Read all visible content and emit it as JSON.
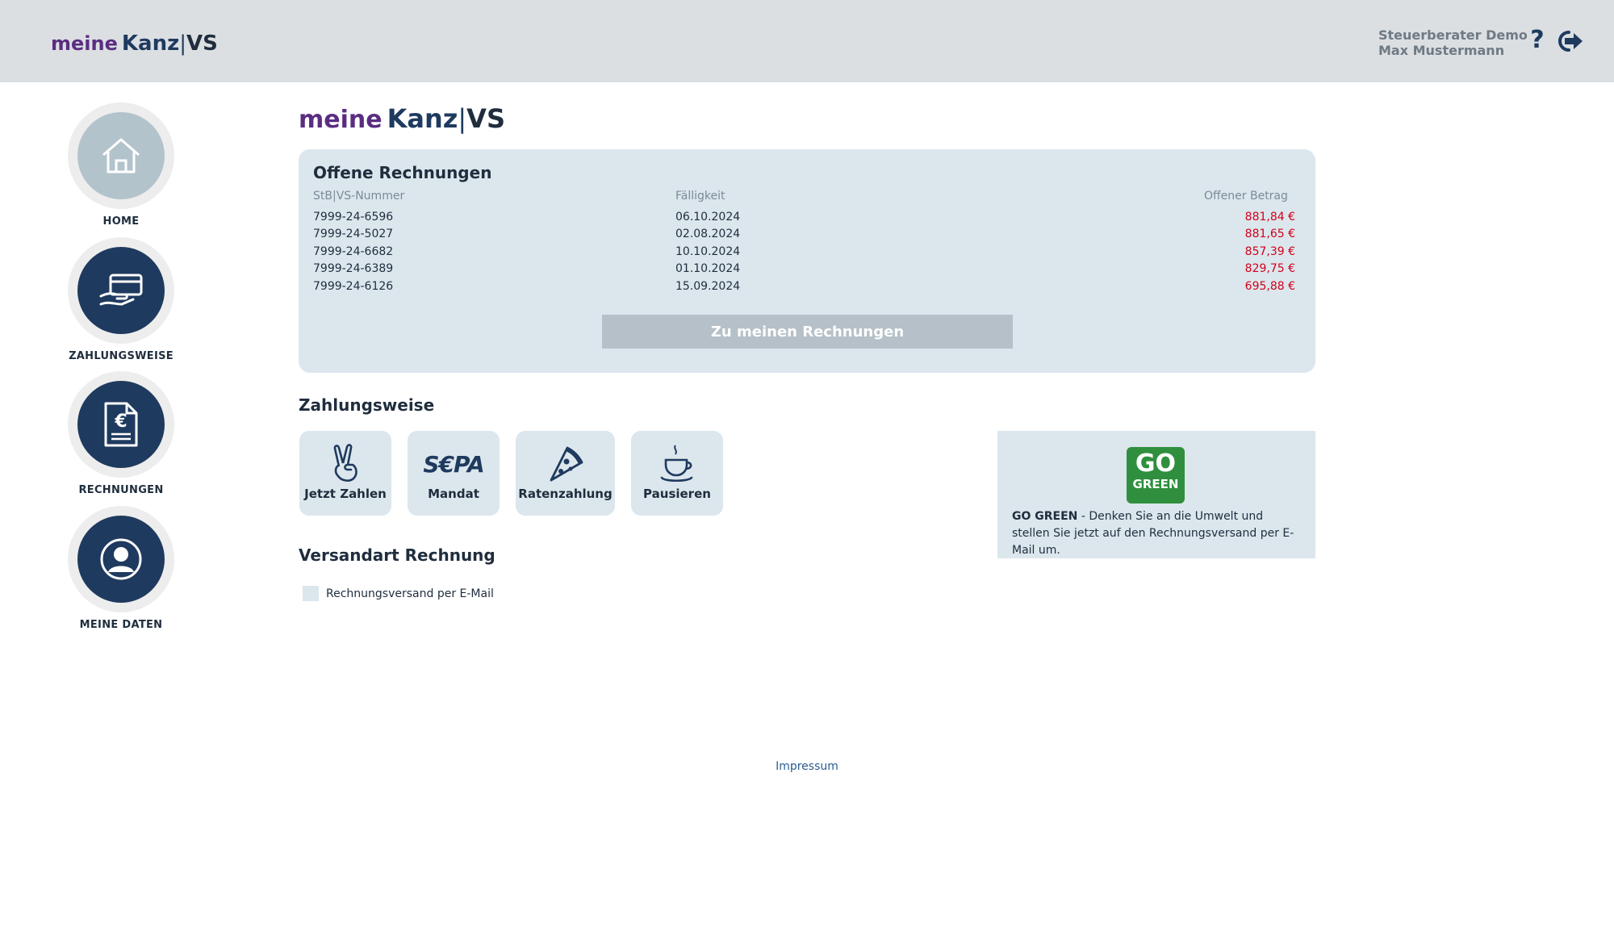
{
  "header": {
    "logo": {
      "meine": "meine",
      "kanz": "Kanz",
      "separator": "|",
      "vs": "VS"
    },
    "user": {
      "line1": "Steuerberater Demo",
      "line2": "Max Mustermann"
    },
    "help_icon": "?",
    "logout_icon": "logout-icon"
  },
  "sidebar": {
    "items": [
      {
        "label": "HOME",
        "icon": "home-icon",
        "active": true
      },
      {
        "label": "ZAHLUNGSWEISE",
        "icon": "payment-hand-card-icon",
        "active": false
      },
      {
        "label": "RECHNUNGEN",
        "icon": "euro-invoice-icon",
        "active": false
      },
      {
        "label": "MEINE DATEN",
        "icon": "user-icon",
        "active": false
      }
    ]
  },
  "main": {
    "logo": {
      "meine": "meine",
      "kanz": "Kanz",
      "separator": "|",
      "vs": "VS"
    },
    "invoices": {
      "title": "Offene Rechnungen",
      "columns": {
        "number": "StB|VS-Nummer",
        "due": "Fälligkeit",
        "amount": "Offener Betrag"
      },
      "rows": [
        {
          "number": "7999-24-6596",
          "due": "06.10.2024",
          "amount": "881,84 €"
        },
        {
          "number": "7999-24-5027",
          "due": "02.08.2024",
          "amount": "881,65 €"
        },
        {
          "number": "7999-24-6682",
          "due": "10.10.2024",
          "amount": "857,39 €"
        },
        {
          "number": "7999-24-6389",
          "due": "01.10.2024",
          "amount": "829,75 €"
        },
        {
          "number": "7999-24-6126",
          "due": "15.09.2024",
          "amount": "695,88 €"
        }
      ],
      "button_label": "Zu meinen Rechnungen"
    },
    "payment": {
      "title": "Zahlungsweise",
      "tiles": [
        {
          "label": "Jetzt Zahlen",
          "icon": "victory-hand-icon"
        },
        {
          "label": "Mandat",
          "icon": "sepa-logo",
          "icon_text": "S€PA"
        },
        {
          "label": "Ratenzahlung",
          "icon": "pizza-slice-icon"
        },
        {
          "label": "Pausieren",
          "icon": "coffee-cup-icon"
        }
      ]
    },
    "gogreen": {
      "badge_go": "GO",
      "badge_green": "GREEN",
      "bold": "GO GREEN",
      "text": " - Denken Sie an die Umwelt und stellen Sie jetzt auf den Rechnungsversand per E-Mail um."
    },
    "shipping": {
      "title": "Versandart Rechnung",
      "checkbox_label": "Rechnungsversand per E-Mail",
      "checked": false
    }
  },
  "footer": {
    "impressum": "Impressum"
  },
  "colors": {
    "header_bg": "#dbdfe2",
    "accent_navy": "#1f3a5f",
    "brand_purple": "#5a2d82",
    "card_bg": "#dce6ed",
    "amount_red": "#d0021b",
    "button_gray": "#b5c0c8",
    "green_badge": "#2f8f3e"
  }
}
